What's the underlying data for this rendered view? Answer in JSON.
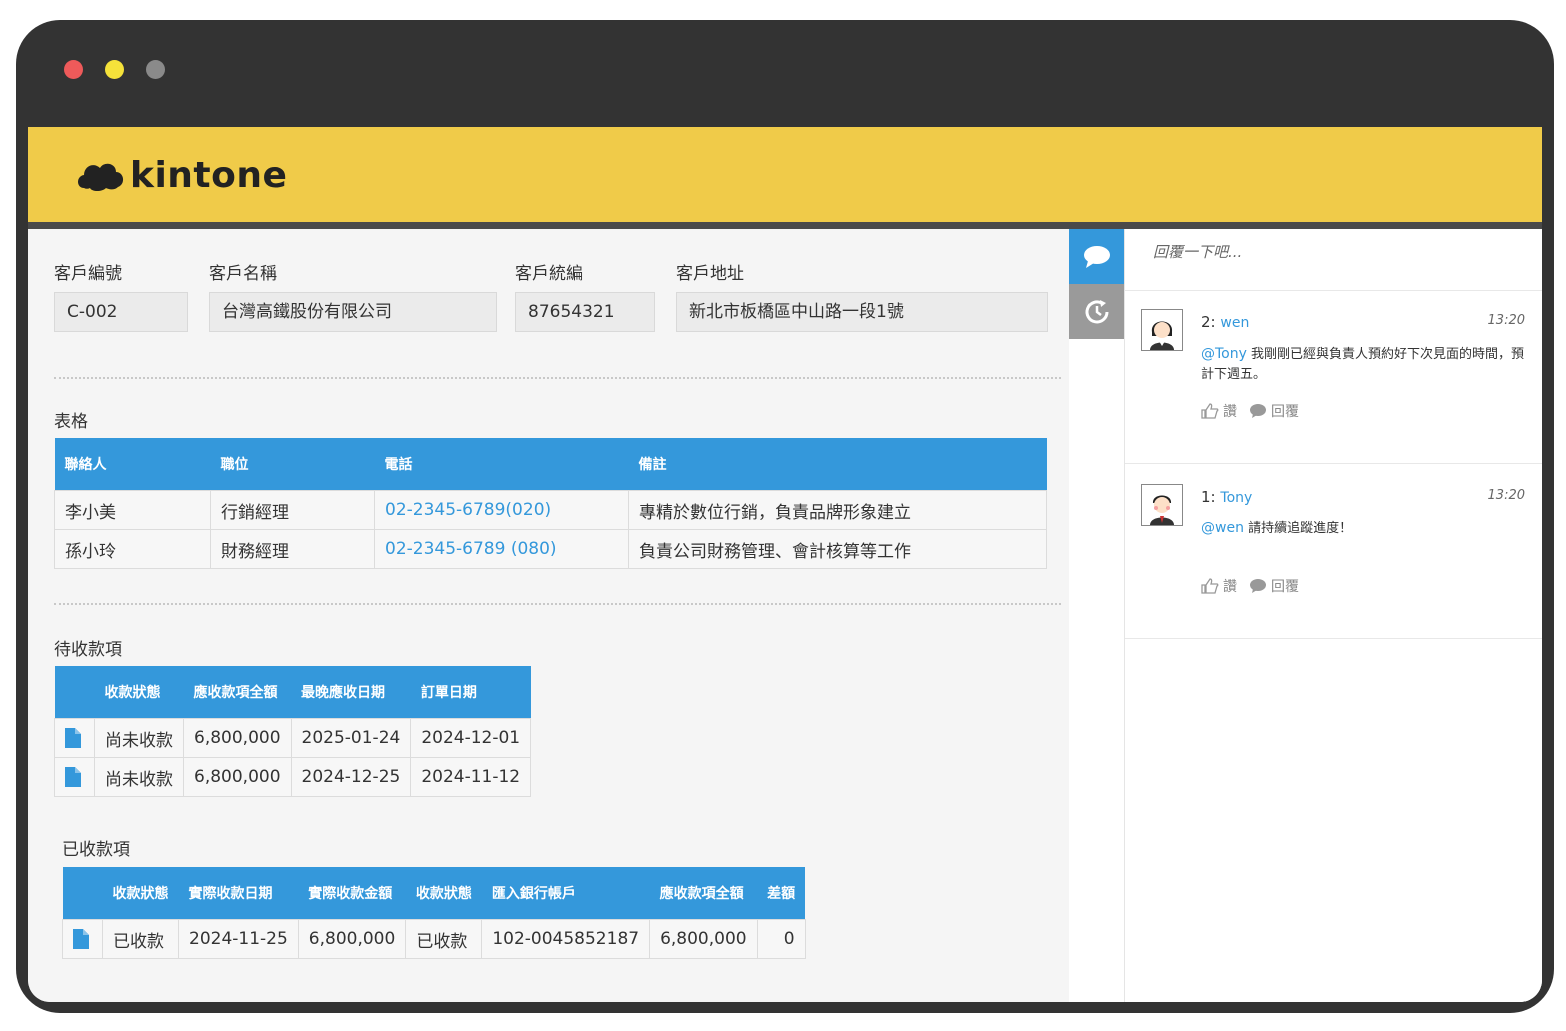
{
  "window": {
    "dot_colors": [
      "#ee5a5a",
      "#f5e23a",
      "#8a8a8a"
    ]
  },
  "app": {
    "logo_text": "kintone",
    "brand_color": "#f0cb49"
  },
  "record": {
    "fields": [
      {
        "label": "客戶編號",
        "value": "C-002"
      },
      {
        "label": "客戶名稱",
        "value": "台灣高鐵股份有限公司"
      },
      {
        "label": "客戶統編",
        "value": "87654321"
      },
      {
        "label": "客戶地址",
        "value": "新北市板橋區中山路一段1號"
      }
    ]
  },
  "contacts": {
    "title": "表格",
    "headers": [
      "聯絡人",
      "職位",
      "電話",
      "備註"
    ],
    "rows": [
      [
        "李小美",
        "行銷經理",
        "02-2345-6789(020)",
        "專精於數位行銷，負責品牌形象建立"
      ],
      [
        "孫小玲",
        "財務經理",
        "02-2345-6789 (080)",
        "負責公司財務管理、會計核算等工作"
      ]
    ]
  },
  "receivables": {
    "title": "待收款項",
    "headers": [
      "收款狀態",
      "應收款項全額",
      "最晚應收日期",
      "訂單日期"
    ],
    "rows": [
      [
        "尚未收款",
        "6,800,000",
        "2025-01-24",
        "2024-12-01"
      ],
      [
        "尚未收款",
        "6,800,000",
        "2024-12-25",
        "2024-11-12"
      ]
    ]
  },
  "received": {
    "title": "已收款項",
    "headers": [
      "收款狀態",
      "實際收款日期",
      "實際收款金額",
      "收款狀態",
      "匯入銀行帳戶",
      "應收款項全額",
      "差額"
    ],
    "rows": [
      [
        "已收款",
        "2024-11-25",
        "6,800,000",
        "已收款",
        "102-0045852187",
        "6,800,000",
        "0"
      ]
    ]
  },
  "sidebar": {
    "reply_placeholder": "回覆一下吧...",
    "like_label": "讚",
    "reply_label": "回覆",
    "posts": [
      {
        "num": "2:",
        "author": "wen",
        "time": "13:20",
        "mention": "@Tony",
        "text": "我剛剛已經與負責人預約好下次見面的時間，預計下週五。"
      },
      {
        "num": "1:",
        "author": "Tony",
        "time": "13:20",
        "mention": "@wen",
        "text": "請持續追蹤進度！"
      }
    ]
  }
}
